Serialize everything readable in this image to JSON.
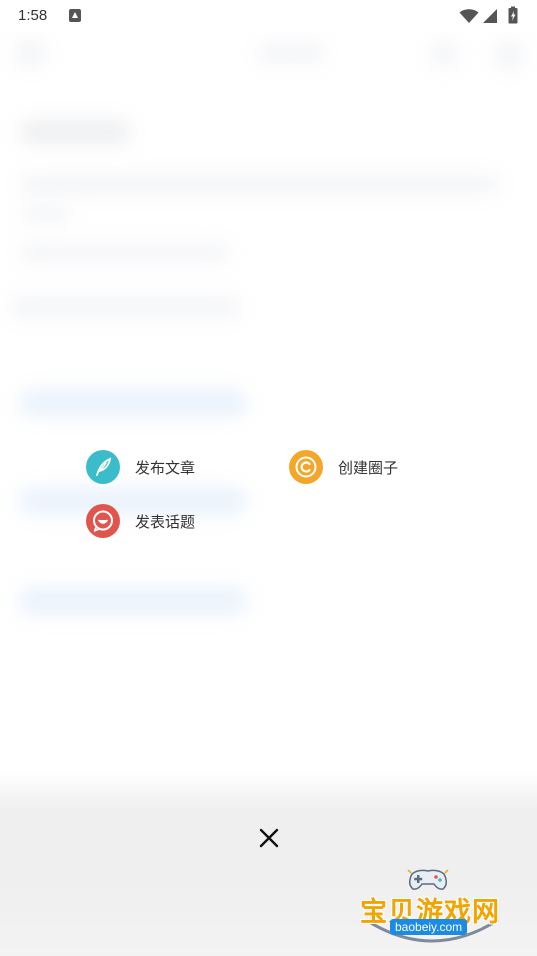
{
  "status_bar": {
    "time": "1:58"
  },
  "publish_menu": {
    "items": [
      {
        "label": "发布文章",
        "icon": "feather-icon",
        "color": "#3bbccb"
      },
      {
        "label": "创建圈子",
        "icon": "circle-c-icon",
        "color": "#f4a62a"
      },
      {
        "label": "发表话题",
        "icon": "chat-face-icon",
        "color": "#e0564f"
      }
    ]
  },
  "close_icon": "close-icon",
  "watermark": {
    "text": "宝贝游戏网",
    "domain": "baobeiy.com"
  }
}
